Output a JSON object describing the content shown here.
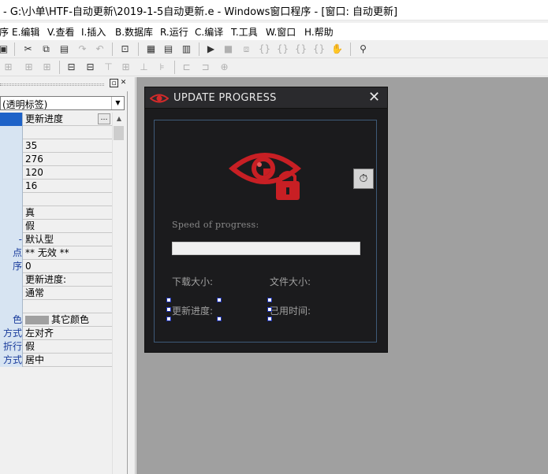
{
  "window": {
    "title": "- G:\\小单\\HTF-自动更新\\2019-1-5自动更新.e - Windows窗口程序 - [窗口: 自动更新]"
  },
  "menu": [
    "序",
    "E.编辑",
    "V.查看",
    "I.插入",
    "B.数据库",
    "R.运行",
    "C.编译",
    "T.工具",
    "W.窗口",
    "H.帮助"
  ],
  "properties": {
    "component": "(透明标签)",
    "rows": [
      {
        "key": "",
        "value": "更新进度",
        "selected": true,
        "ellipsis": true
      },
      {
        "key": "",
        "value": ""
      },
      {
        "key": "",
        "value": "35"
      },
      {
        "key": "",
        "value": "276"
      },
      {
        "key": "",
        "value": "120"
      },
      {
        "key": "",
        "value": "16"
      },
      {
        "key": "",
        "value": ""
      },
      {
        "key": "",
        "value": "真"
      },
      {
        "key": "",
        "value": "假"
      },
      {
        "key": "-",
        "value": "默认型"
      },
      {
        "key": "点",
        "value": "** 无效 **"
      },
      {
        "key": "序",
        "value": "0"
      },
      {
        "key": "",
        "value": "更新进度:"
      },
      {
        "key": "",
        "value": "通常"
      },
      {
        "key": "",
        "value": ""
      },
      {
        "key": "色",
        "value": "其它颜色",
        "swatch": "#a0a0a0"
      },
      {
        "key": "方式",
        "value": "左对齐"
      },
      {
        "key": "折行",
        "value": "假"
      },
      {
        "key": "方式",
        "value": "居中"
      }
    ]
  },
  "form": {
    "title": "UPDATE PROGRESS",
    "speed_label": "Speed of progress:",
    "progress": 0,
    "download_size_label": "下载大小:",
    "file_size_label": "文件大小:",
    "update_progress_label": "更新进度:",
    "elapsed_label": "已用时间:"
  },
  "colors": {
    "accent_red": "#d42a2a",
    "form_bg": "#1b1b1d",
    "canvas_bg": "#a0a0a0",
    "selection": "#1e62c8"
  },
  "icons": {
    "toolbar1": [
      "save-icon",
      "cut-icon",
      "copy-icon",
      "paste-icon",
      "redo-icon",
      "undo-icon",
      "preview-icon",
      "layout-a-icon",
      "layout-b-icon",
      "layout-c-icon",
      "run-icon",
      "stop-icon",
      "step-icon",
      "step-into-icon",
      "step-over-icon",
      "step-out-icon",
      "hand-icon",
      "find-icon"
    ],
    "toolbar2": [
      "align-left-icon",
      "align-center-h-icon",
      "align-right-icon",
      "same-width-icon",
      "same-height-icon",
      "align-top-icon",
      "align-middle-v-icon",
      "align-bottom-icon",
      "space-h-icon",
      "space-v-icon",
      "center-icon"
    ]
  }
}
